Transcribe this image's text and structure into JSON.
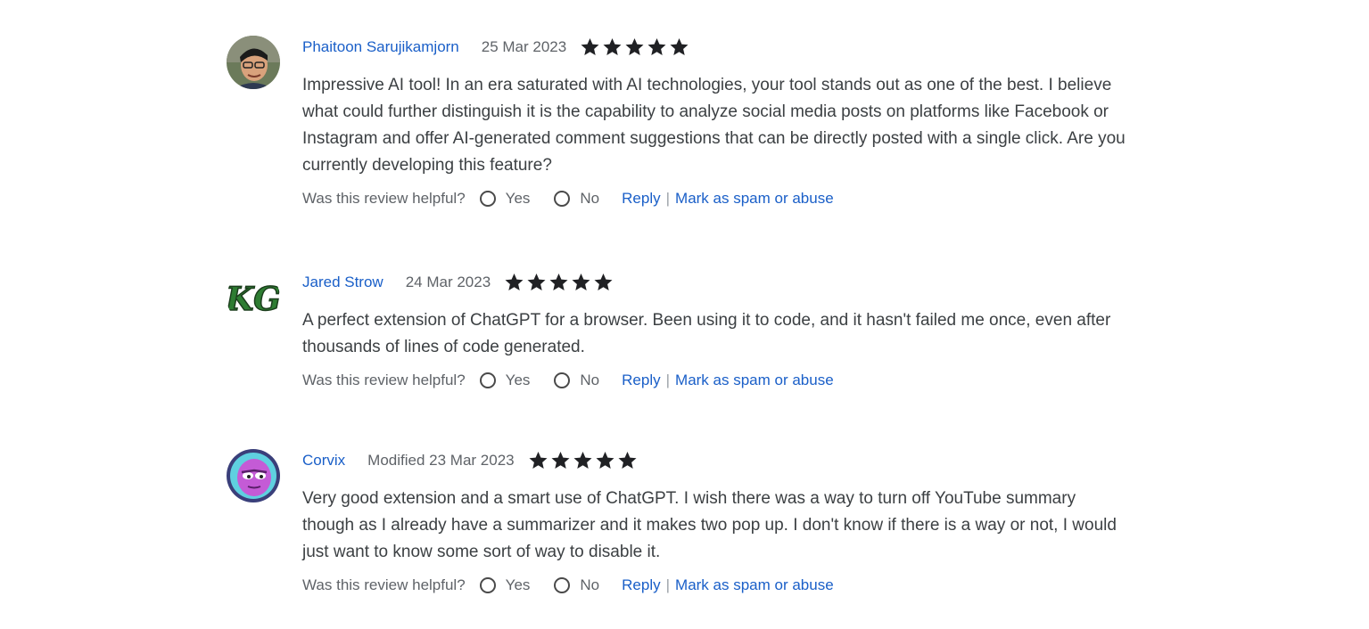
{
  "reviews": [
    {
      "author": "Phaitoon Sarujikamjorn",
      "date": "25 Mar 2023",
      "rating": 5,
      "avatar_icon": "photo-avatar-icon",
      "text": "Impressive AI tool! In an era saturated with AI technologies, your tool stands out as one of the best. I believe what could further distinguish it is the capability to analyze social media posts on platforms like Facebook or Instagram and offer AI-generated comment suggestions that can be directly posted with a single click. Are you currently developing this feature?",
      "helpful_prompt": "Was this review helpful?",
      "yes_label": "Yes",
      "no_label": "No",
      "reply_label": "Reply",
      "separator": "|",
      "spam_label": "Mark as spam or abuse"
    },
    {
      "author": "Jared Strow",
      "date": "24 Mar 2023",
      "rating": 5,
      "avatar_icon": "kg-logo-avatar-icon",
      "avatar_text": "KG",
      "text": "A perfect extension of ChatGPT for a browser. Been using it to code, and it hasn't failed me once, even after thousands of lines of code generated.",
      "helpful_prompt": "Was this review helpful?",
      "yes_label": "Yes",
      "no_label": "No",
      "reply_label": "Reply",
      "separator": "|",
      "spam_label": "Mark as spam or abuse"
    },
    {
      "author": "Corvix",
      "date": "Modified 23 Mar 2023",
      "rating": 5,
      "avatar_icon": "cartoon-avatar-icon",
      "text": "Very good extension and a smart use of ChatGPT. I wish there was a way to turn off YouTube summary though as I already have a summarizer and it makes two pop up. I don't know if there is a way or not, I would just want to know some sort of way to disable it.",
      "helpful_prompt": "Was this review helpful?",
      "yes_label": "Yes",
      "no_label": "No",
      "reply_label": "Reply",
      "separator": "|",
      "spam_label": "Mark as spam or abuse"
    }
  ],
  "colors": {
    "link": "#1a5fc8",
    "muted": "#5f6368",
    "body_text": "#3c4043",
    "star": "#202124"
  }
}
